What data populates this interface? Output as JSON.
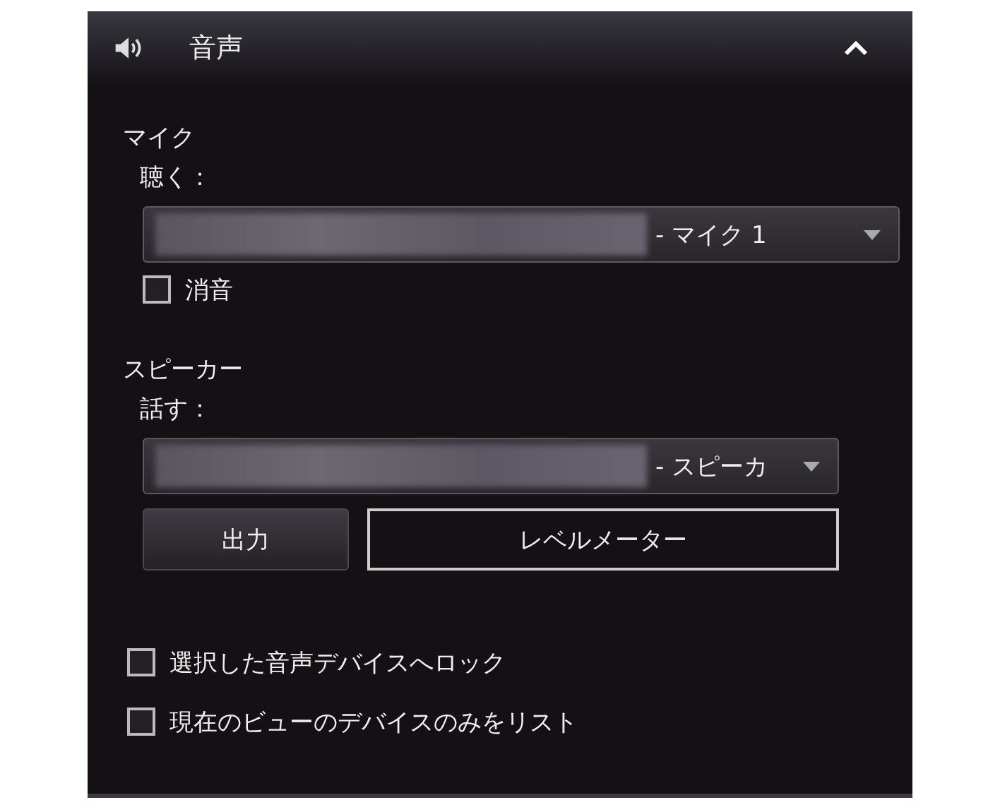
{
  "header": {
    "title": "音声",
    "expanded": true
  },
  "microphone": {
    "heading": "マイク",
    "label": "聴く：",
    "device_suffix": "- マイク 1",
    "muted": {
      "label": "消音",
      "checked": false
    }
  },
  "speaker": {
    "heading": "スピーカー",
    "label": "話す：",
    "device_suffix": "- スピーカ"
  },
  "buttons": [
    {
      "label": "出力",
      "selected": false
    },
    {
      "label": "レベルメーター",
      "selected": true
    }
  ],
  "options": [
    {
      "label": "選択した音声デバイスへロック",
      "checked": false
    },
    {
      "label": "現在のビューのデバイスのみをリスト",
      "checked": false
    }
  ]
}
